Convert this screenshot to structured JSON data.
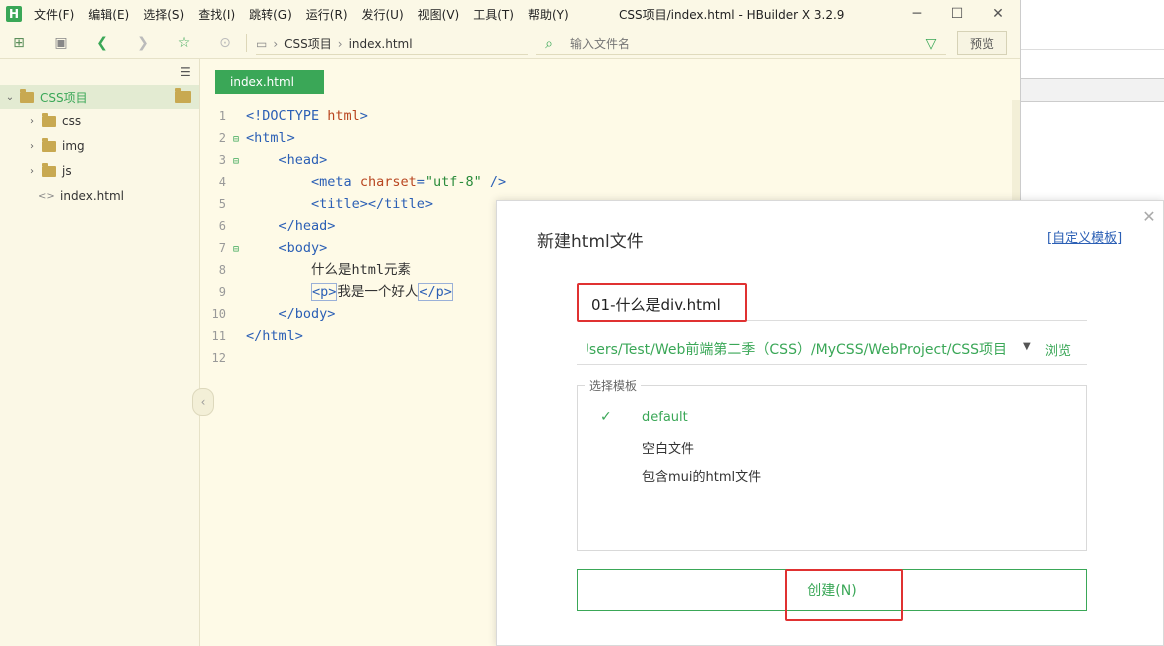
{
  "app": {
    "logo": "H",
    "title": "CSS项目/index.html - HBuilder X 3.2.9",
    "menu": [
      "文件(F)",
      "编辑(E)",
      "选择(S)",
      "查找(I)",
      "跳转(G)",
      "运行(R)",
      "发行(U)",
      "视图(V)",
      "工具(T)",
      "帮助(Y)"
    ]
  },
  "toolbar": {
    "breadcrumb": [
      "CSS项目",
      "index.html"
    ],
    "search_placeholder": "输入文件名",
    "preview_label": "预览",
    "icons": [
      "new-file-icon",
      "save-icon",
      "back-icon",
      "forward-icon",
      "star-icon",
      "run-icon",
      "folder-icon",
      "search-file-icon",
      "filter-icon"
    ]
  },
  "sidebar": {
    "root": "CSS项目",
    "items": [
      {
        "label": "css",
        "type": "folder"
      },
      {
        "label": "img",
        "type": "folder"
      },
      {
        "label": "js",
        "type": "folder"
      },
      {
        "label": "index.html",
        "type": "file"
      }
    ]
  },
  "editor": {
    "tab": "index.html",
    "lines": [
      {
        "n": "1",
        "fold": "",
        "html": "<span class='tk-tag'>&lt;!DOCTYPE </span><span class='tk-attr'>html</span><span class='tk-tag'>&gt;</span>"
      },
      {
        "n": "2",
        "fold": "⊟",
        "html": "<span class='tk-tag'>&lt;html&gt;</span>"
      },
      {
        "n": "3",
        "fold": "⊟",
        "html": "    <span class='tk-tag'>&lt;head&gt;</span>"
      },
      {
        "n": "4",
        "fold": "",
        "html": "        <span class='tk-tag'>&lt;meta </span><span class='tk-attr'>charset</span><span class='tk-tag'>=</span><span class='tk-str'>\"utf-8\"</span><span class='tk-tag'> /&gt;</span>"
      },
      {
        "n": "5",
        "fold": "",
        "html": "        <span class='tk-tag'>&lt;title&gt;&lt;/title&gt;</span>"
      },
      {
        "n": "6",
        "fold": "",
        "html": "    <span class='tk-tag'>&lt;/head&gt;</span>"
      },
      {
        "n": "7",
        "fold": "⊟",
        "html": "    <span class='tk-tag'>&lt;body&gt;</span>"
      },
      {
        "n": "8",
        "fold": "",
        "html": "        <span class='tk-text'>什么是html元素</span>"
      },
      {
        "n": "9",
        "fold": "",
        "html": "        <span class='tk-tag hl-box'>&lt;p&gt;</span><span class='tk-text'>我是一个好人</span><span class='tk-tag hl-box'>&lt;/p&gt;</span>"
      },
      {
        "n": "10",
        "fold": "",
        "html": "    <span class='tk-tag'>&lt;/body&gt;</span>"
      },
      {
        "n": "11",
        "fold": "",
        "html": "<span class='tk-tag'>&lt;/html&gt;</span>"
      },
      {
        "n": "12",
        "fold": "",
        "html": ""
      }
    ]
  },
  "dialog": {
    "title": "新建html文件",
    "custom_template": "[自定义模板]",
    "filename": "01-什么是div.html",
    "path": "C:/Users/Test/Web前端第二季（CSS）/MyCSS/WebProject/CSS项目",
    "browse": "浏览",
    "template_legend": "选择模板",
    "templates": [
      "default",
      "空白文件",
      "包含mui的html文件"
    ],
    "create_label": "创建(N)"
  },
  "colors": {
    "accent": "#3aa757",
    "highlight": "#e03131",
    "background": "#fefae7"
  }
}
